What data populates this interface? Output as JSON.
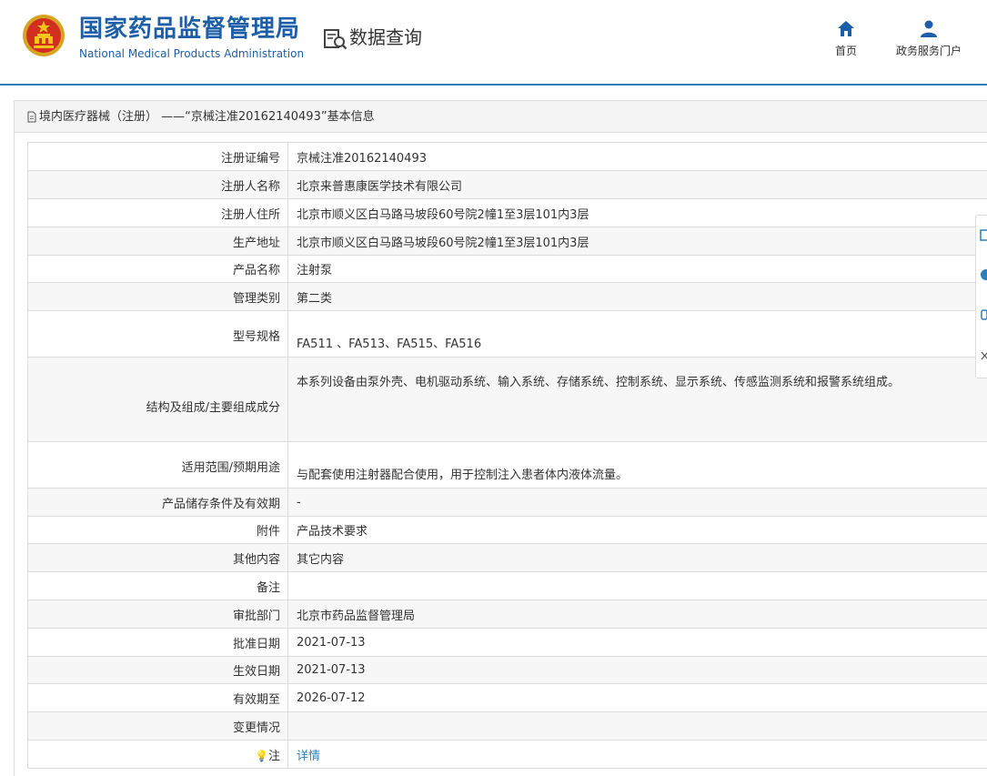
{
  "header": {
    "org_name_cn": "国家药品监督管理局",
    "org_name_en": "National Medical Products Administration",
    "query_label": "数据查询",
    "nav": {
      "home_label": "首页",
      "portal_label": "政务服务门户"
    }
  },
  "colors": {
    "brand": "#1c5fa8",
    "link": "#2c7fb8",
    "row_stripe": "#f7f7f7",
    "border": "#dcdcdc"
  },
  "icons": {
    "logo": "national-emblem-icon",
    "query": "document-search-icon",
    "home": "home-icon",
    "portal": "user-icon",
    "title": "document-icon",
    "note": "lightbulb-icon"
  },
  "panel": {
    "title": "境内医疗器械（注册） ——“京械注准20162140493”基本信息"
  },
  "rows": [
    {
      "label": "注册证编号",
      "value": "京械注准20162140493"
    },
    {
      "label": "注册人名称",
      "value": "北京来普惠康医学技术有限公司"
    },
    {
      "label": "注册人住所",
      "value": "北京市顺义区白马路马坡段60号院2幢1至3层101内3层"
    },
    {
      "label": "生产地址",
      "value": "北京市顺义区白马路马坡段60号院2幢1至3层101内3层"
    },
    {
      "label": "产品名称",
      "value": "注射泵"
    },
    {
      "label": "管理类别",
      "value": "第二类"
    },
    {
      "label": "型号规格",
      "value": "FA511 、FA513、FA515、FA516"
    },
    {
      "label": "结构及组成/主要组成成分",
      "value": "本系列设备由泵外壳、电机驱动系统、输入系统、存储系统、控制系统、显示系统、传感监测系统和报警系统组成。"
    },
    {
      "label": "适用范围/预期用途",
      "value": "与配套使用注射器配合使用，用于控制注入患者体内液体流量。"
    },
    {
      "label": "产品储存条件及有效期",
      "value": "-"
    },
    {
      "label": "附件",
      "value": "产品技术要求"
    },
    {
      "label": "其他内容",
      "value": "其它内容"
    },
    {
      "label": "备注",
      "value": ""
    },
    {
      "label": "审批部门",
      "value": "北京市药品监督管理局"
    },
    {
      "label": "批准日期",
      "value": "2021-07-13"
    },
    {
      "label": "生效日期",
      "value": "2021-07-13"
    },
    {
      "label": "有效期至",
      "value": "2026-07-12"
    },
    {
      "label": "变更情况",
      "value": ""
    },
    {
      "label": "注",
      "value": "详情"
    }
  ]
}
